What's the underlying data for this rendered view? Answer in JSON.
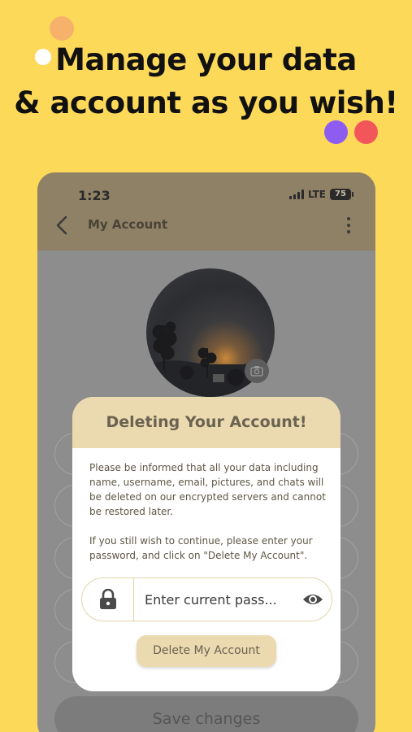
{
  "headline": {
    "line1": "Manage your data",
    "line2": "& account as you wish!"
  },
  "status_bar": {
    "time": "1:23",
    "network": "LTE",
    "battery": "75"
  },
  "app_bar": {
    "title": "My Account"
  },
  "background_form": {
    "save_label": "Save changes"
  },
  "dialog": {
    "title": "Deleting Your Account!",
    "paragraph1": "Please be informed that all your data including name, username, email, pictures, and chats will be deleted on our encrypted servers and cannot be restored later.",
    "paragraph2": "If you still wish to continue, please enter your password, and click on \"Delete My Account\".",
    "password_placeholder": "Enter current pass...",
    "password_value": "",
    "delete_label": "Delete My Account"
  },
  "colors": {
    "background": "#FDD95A",
    "dialog_accent": "#EBDAB0",
    "dot_purple": "#8E5CF0",
    "dot_red": "#F2565A",
    "dot_orange": "#F6B26B"
  },
  "icons": [
    "back-arrow-icon",
    "more-vert-icon",
    "camera-icon",
    "lock-icon",
    "eye-icon",
    "signal-icon",
    "battery-icon"
  ]
}
